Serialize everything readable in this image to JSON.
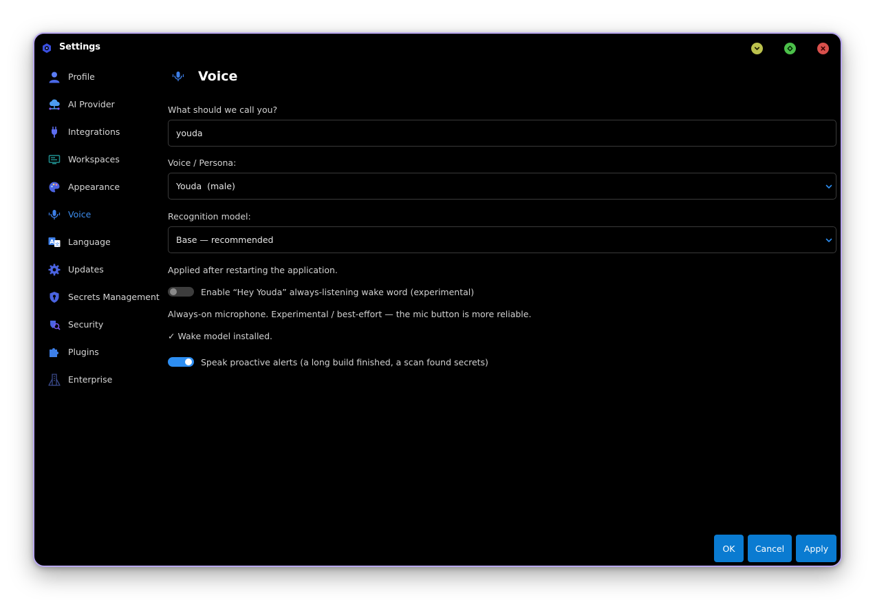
{
  "window": {
    "title": "Settings",
    "icons": {
      "app": "gear-badge-icon",
      "minimize": "chevron-down-icon",
      "maximize": "diamond-icon",
      "close": "close-icon"
    }
  },
  "sidebar": {
    "items": [
      {
        "label": "Profile",
        "icon": "user-icon"
      },
      {
        "label": "AI Provider",
        "icon": "cloud-network-icon"
      },
      {
        "label": "Integrations",
        "icon": "plug-icon"
      },
      {
        "label": "Workspaces",
        "icon": "monitor-icon"
      },
      {
        "label": "Appearance",
        "icon": "palette-icon"
      },
      {
        "label": "Voice",
        "icon": "microphone-icon",
        "active": true
      },
      {
        "label": "Language",
        "icon": "translate-icon"
      },
      {
        "label": "Updates",
        "icon": "gear-icon"
      },
      {
        "label": "Secrets Management",
        "icon": "shield-lock-icon"
      },
      {
        "label": "Security",
        "icon": "security-icon"
      },
      {
        "label": "Plugins",
        "icon": "puzzle-icon"
      },
      {
        "label": "Enterprise",
        "icon": "building-icon"
      }
    ]
  },
  "page": {
    "title": "Voice",
    "icon": "microphone-icon",
    "name_label": "What should we call you?",
    "name_value": "youda",
    "persona_label": "Voice / Persona:",
    "persona_value": "Youda  (male)",
    "model_label": "Recognition model:",
    "model_value": "Base — recommended",
    "restart_note": "Applied after restarting the application.",
    "wake_toggle_label": "Enable “Hey Youda” always-listening wake word (experimental)",
    "wake_toggle_on": false,
    "mic_note": "Always-on microphone. Experimental / best-effort — the mic button is more reliable.",
    "wake_status": "✓ Wake model installed.",
    "alerts_toggle_label": "Speak proactive alerts (a long build finished, a scan found secrets)",
    "alerts_toggle_on": true
  },
  "buttons": {
    "ok": "OK",
    "cancel": "Cancel",
    "apply": "Apply"
  },
  "colors": {
    "accent": "#0a7bd1",
    "active_nav": "#3d8ef0",
    "toggle_on": "#2d8ef2",
    "window_border": "#b9a8f0"
  }
}
